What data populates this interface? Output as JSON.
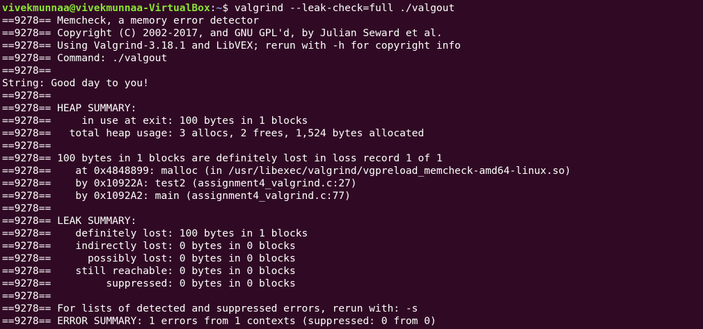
{
  "terminal": {
    "prompt": {
      "user_host": "vivekmunnaa@vivekmunnaa-VirtualBox",
      "separator": ":",
      "path": "~",
      "symbol": "$",
      "command": "valgrind --leak-check=full ./valgout"
    },
    "lines": [
      "==9278== Memcheck, a memory error detector",
      "==9278== Copyright (C) 2002-2017, and GNU GPL'd, by Julian Seward et al.",
      "==9278== Using Valgrind-3.18.1 and LibVEX; rerun with -h for copyright info",
      "==9278== Command: ./valgout",
      "==9278==",
      "String: Good day to you!",
      "==9278==",
      "==9278== HEAP SUMMARY:",
      "==9278==     in use at exit: 100 bytes in 1 blocks",
      "==9278==   total heap usage: 3 allocs, 2 frees, 1,524 bytes allocated",
      "==9278==",
      "==9278== 100 bytes in 1 blocks are definitely lost in loss record 1 of 1",
      "==9278==    at 0x4848899: malloc (in /usr/libexec/valgrind/vgpreload_memcheck-amd64-linux.so)",
      "==9278==    by 0x10922A: test2 (assignment4_valgrind.c:27)",
      "==9278==    by 0x1092A2: main (assignment4_valgrind.c:77)",
      "==9278==",
      "==9278== LEAK SUMMARY:",
      "==9278==    definitely lost: 100 bytes in 1 blocks",
      "==9278==    indirectly lost: 0 bytes in 0 blocks",
      "==9278==      possibly lost: 0 bytes in 0 blocks",
      "==9278==    still reachable: 0 bytes in 0 blocks",
      "==9278==         suppressed: 0 bytes in 0 blocks",
      "==9278==",
      "==9278== For lists of detected and suppressed errors, rerun with: -s",
      "==9278== ERROR SUMMARY: 1 errors from 1 contexts (suppressed: 0 from 0)"
    ],
    "colors": {
      "background": "#300a24",
      "text": "#ffffff",
      "prompt_user": "#8ae234",
      "prompt_path": "#729fcf"
    }
  }
}
